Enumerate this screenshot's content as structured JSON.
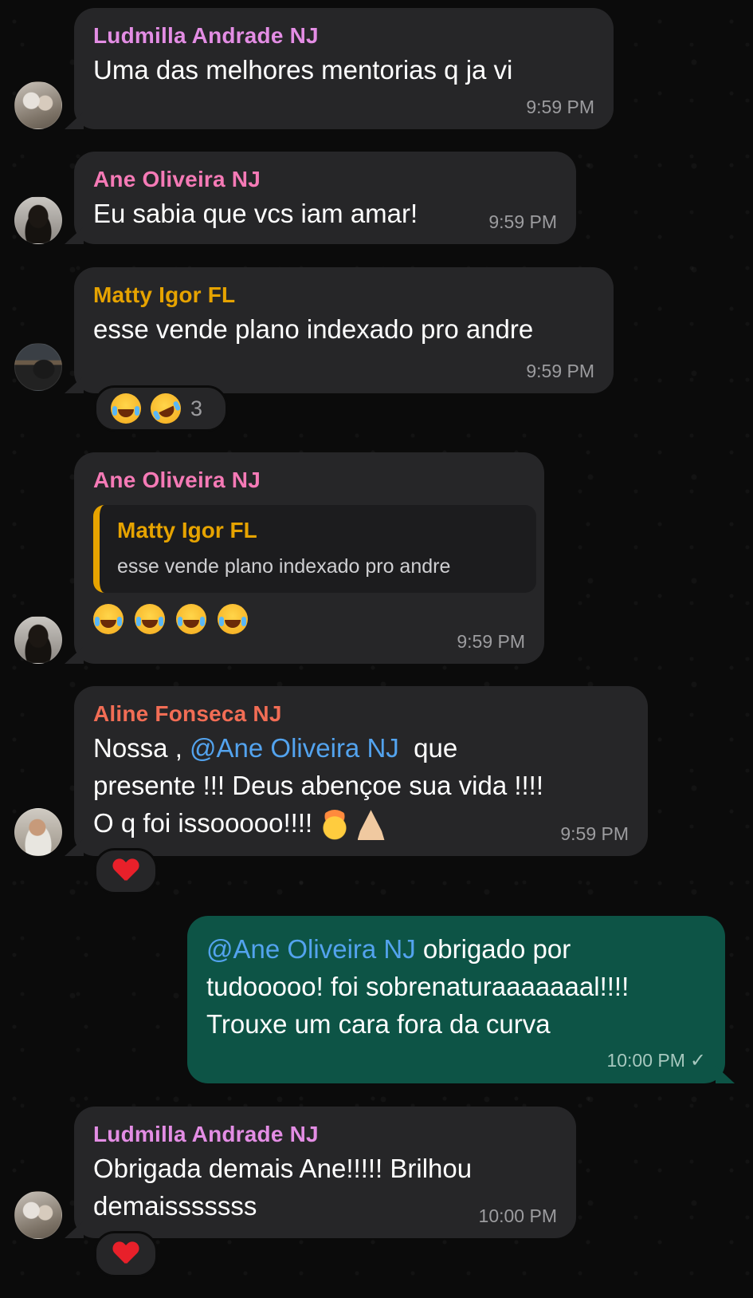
{
  "colors": {
    "ludmilla": "#e38de4",
    "ane": "#f57ab6",
    "matty": "#e6a300",
    "aline": "#f26d55",
    "mention": "#53a3ee",
    "incoming_bubble": "#262628",
    "outgoing_bubble": "#0d5446"
  },
  "messages": [
    {
      "sender": "Ludmilla Andrade NJ",
      "text": "Uma das melhores mentorias q ja vi",
      "time": "9:59 PM"
    },
    {
      "sender": "Ane Oliveira NJ",
      "text": "Eu sabia que vcs iam amar!",
      "time": "9:59 PM"
    },
    {
      "sender": "Matty Igor FL",
      "text": "esse vende plano indexado pro andre",
      "time": "9:59 PM",
      "reactions": {
        "emojis": [
          "face-with-tears-of-joy",
          "rolling-on-the-floor-laughing"
        ],
        "count": "3"
      }
    },
    {
      "sender": "Ane Oliveira NJ",
      "quote": {
        "sender": "Matty Igor FL",
        "text": "esse vende plano indexado pro andre"
      },
      "emojis": [
        "face-with-tears-of-joy",
        "face-with-tears-of-joy",
        "face-with-tears-of-joy",
        "face-with-tears-of-joy"
      ],
      "time": "9:59 PM"
    },
    {
      "sender": "Aline Fonseca NJ",
      "text_before": "Nossa , ",
      "mention": "@Ane Oliveira NJ",
      "text_after": "  que",
      "line2": "presente !!! Deus abençoe sua vida !!!!",
      "line3": "O q foi issooooo!!!!",
      "emojis": [
        "exploding-head",
        "folded-hands"
      ],
      "time": "9:59 PM",
      "reactions": {
        "emojis": [
          "red-heart"
        ]
      }
    },
    {
      "outgoing": true,
      "mention": "@Ane Oliveira NJ",
      "line1_after": " obrigado por",
      "line2": "tudooooo! foi sobrenaturaaaaaaal!!!!",
      "line3": "Trouxe um cara fora da curva",
      "time": "10:00 PM",
      "status_icon": "single-check-icon"
    },
    {
      "sender": "Ludmilla Andrade NJ",
      "line1": "Obrigada demais Ane!!!!! Brilhou",
      "line2": "demaisssssss",
      "time": "10:00 PM",
      "reactions": {
        "emojis": [
          "red-heart"
        ]
      }
    }
  ]
}
